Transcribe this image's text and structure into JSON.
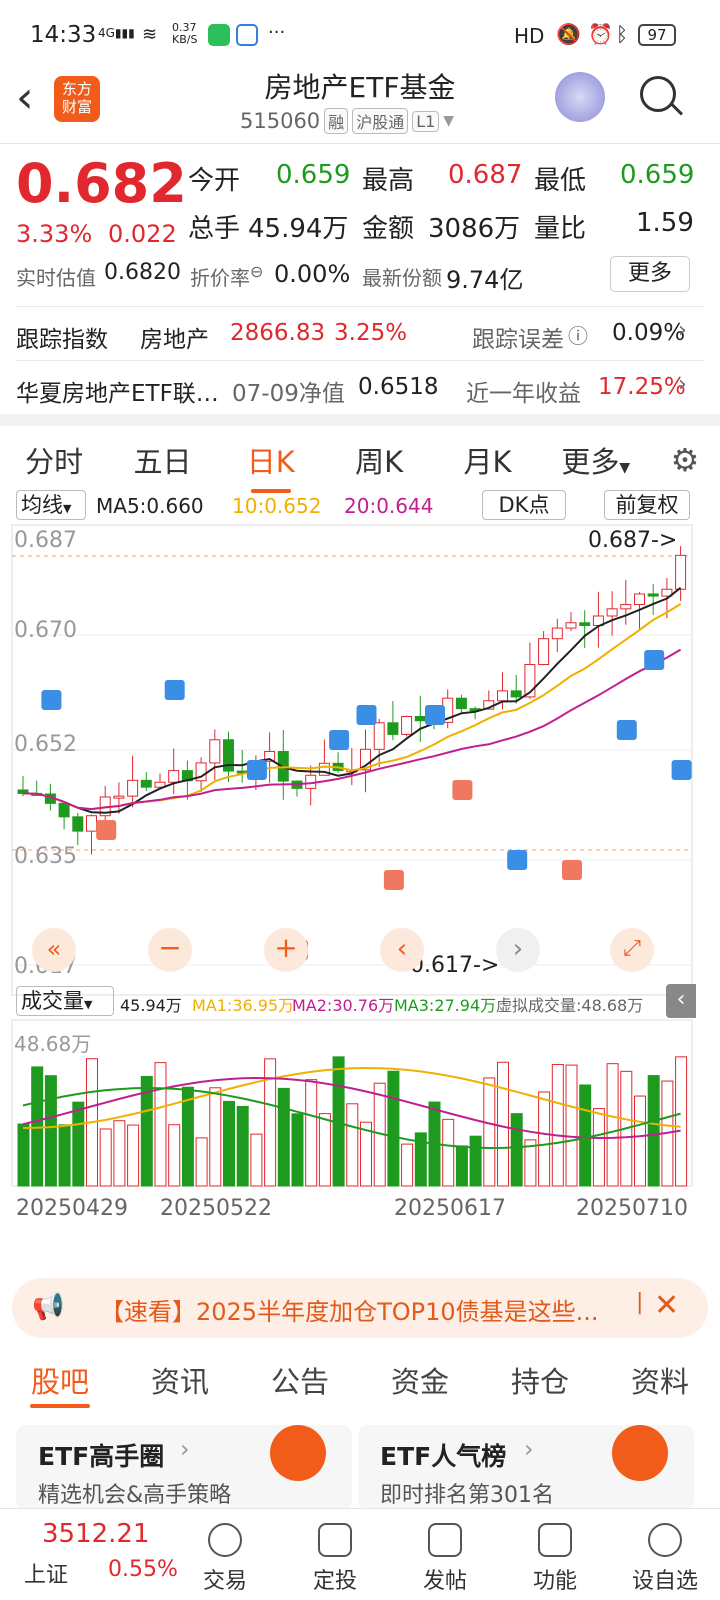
{
  "status": {
    "time": "14:33",
    "net": "4G",
    "speed": "0.37\nKB/S",
    "hd": "HD",
    "battery": "97"
  },
  "header": {
    "title": "房地产ETF基金",
    "code": "515060",
    "tags": [
      "融",
      "沪股通",
      "L1"
    ],
    "logo": "东方\n财富"
  },
  "quote": {
    "price": "0.682",
    "pct": "3.33%",
    "chg": "0.022",
    "open_l": "今开",
    "open": "0.659",
    "high_l": "最高",
    "high": "0.687",
    "low_l": "最低",
    "low": "0.659",
    "vol_l": "总手",
    "vol": "45.94万",
    "amt_l": "金额",
    "amt": "3086万",
    "ratio_l": "量比",
    "ratio": "1.59",
    "est_l": "实时估值",
    "est": "0.6820",
    "disc_l": "折价率",
    "disc": "0.00%",
    "share_l": "最新份额",
    "share": "9.74亿",
    "more": "更多"
  },
  "track": {
    "label": "跟踪指数",
    "name": "房地产",
    "val": "2866.83",
    "pct": "3.25%",
    "err_l": "跟踪误差",
    "err": "0.09%"
  },
  "fund": {
    "name": "华夏房地产ETF联…",
    "nav_l": "07-09净值",
    "nav": "0.6518",
    "ret_l": "近一年收益",
    "ret": "17.25%"
  },
  "tabs": [
    "分时",
    "五日",
    "日K",
    "周K",
    "月K",
    "更多"
  ],
  "ma": {
    "sel": "均线",
    "ma5": "MA5:0.660",
    "ma10": "10:0.652",
    "ma20": "20:0.644",
    "dk": "DK点",
    "fq": "前复权"
  },
  "axis": {
    "y1": "0.687",
    "y2": "0.670",
    "y3": "0.652",
    "y4": "0.635",
    "y5": "0.617",
    "hi": "0.687->",
    "lo": "0.617->"
  },
  "volbar": {
    "sel": "成交量",
    "v": "45.94万",
    "ma1": "MA1:36.95万",
    "ma2": "MA2:30.76万",
    "ma3": "MA3:27.94万",
    "virt": "虚拟成交量:48.68万",
    "ymax": "48.68万"
  },
  "dates": [
    "20250429",
    "20250522",
    "20250617",
    "20250710"
  ],
  "banner": "【速看】2025半年度加仓TOP10债基是这些...",
  "subtabs": [
    "股吧",
    "资讯",
    "公告",
    "资金",
    "持仓",
    "资料"
  ],
  "cards": [
    {
      "t": "ETF高手圈",
      "s": "精选机会&高手策略"
    },
    {
      "t": "ETF人气榜",
      "s": "即时排名第301名"
    }
  ],
  "bottom": {
    "idx": "3512.21",
    "idx_name": "上证",
    "idx_pct": "0.55%",
    "items": [
      "交易",
      "定投",
      "发帖",
      "功能",
      "设自选"
    ]
  },
  "colors": {
    "up": "#e0282e",
    "down": "#1e9b1e",
    "ma5": "#222",
    "ma10": "#f0b000",
    "ma20": "#c0208f"
  }
}
